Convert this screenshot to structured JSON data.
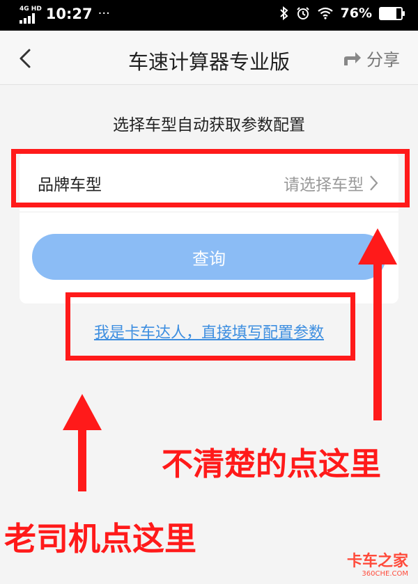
{
  "status_bar": {
    "network": "4G HD",
    "time": "10:27",
    "more": "···",
    "battery": "76%",
    "battery_level": 0.76
  },
  "header": {
    "title": "车速计算器专业版",
    "share_label": "分享"
  },
  "subtitle": "选择车型自动获取参数配置",
  "form": {
    "brand_label": "品牌车型",
    "brand_placeholder": "请选择车型",
    "query_label": "查询"
  },
  "manual_link": "我是卡车达人，直接填写配置参数",
  "annotations": {
    "unclear_hint": "不清楚的点这里",
    "veteran_hint": "老司机点这里",
    "color": "#ff1a1a"
  },
  "watermark": {
    "main": "卡车之家",
    "sub": "360CHE.COM"
  },
  "colors": {
    "accent_button": "#8bbcf5",
    "link": "#3d8ee0"
  }
}
